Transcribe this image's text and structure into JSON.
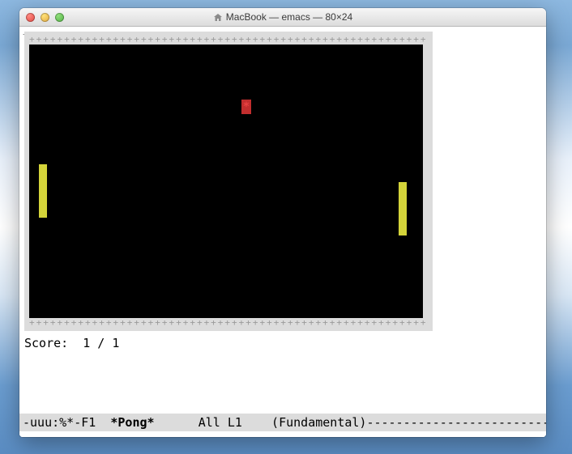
{
  "window": {
    "title": "MacBook — emacs — 80×24"
  },
  "game": {
    "border_char_row": "++++++++++++++++++++++++++++++++++++++++++++++++++++++++++++++++++++++++++++++++",
    "ball_glyph": "*",
    "paddle_color": "#d4d43a",
    "ball_color": "#c22e2e",
    "left_paddle": {
      "col": 1,
      "row": 10,
      "height_rows": 4
    },
    "right_paddle": {
      "col": 74,
      "row": 12,
      "height_rows": 4
    },
    "ball_pos": {
      "col": 42,
      "row": 5
    }
  },
  "score": {
    "label": "Score:  ",
    "left": 1,
    "sep": " / ",
    "right": 1
  },
  "modeline": {
    "left": "-uuu:%*-F1  ",
    "buffer": "*Pong*",
    "mid": "      All L1    (Fundamental)",
    "dashes": "------------------------------------"
  }
}
